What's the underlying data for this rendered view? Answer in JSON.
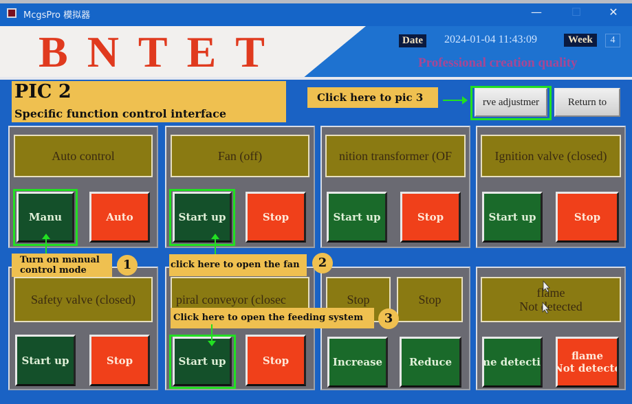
{
  "window": {
    "title": "McgsPro 模拟器",
    "minimize_icon": "minimize-icon",
    "maximize_icon": "maximize-icon",
    "close_icon": "close-icon",
    "minimize_glyph": "—",
    "maximize_glyph": "☐",
    "close_glyph": "✕"
  },
  "header": {
    "logo": "BNTET",
    "date_label": "Date",
    "date_value": "2024-01-04 11:43:09",
    "week_label": "Week",
    "week_value": "4",
    "slogan": "Professional creation quality"
  },
  "page": {
    "title": "PIC 2",
    "subtitle": "Specific function control interface"
  },
  "nav": {
    "hint": "Click here to pic 3",
    "curve_button": "rve adjustmer",
    "return_button": "Return to"
  },
  "panels": [
    {
      "status": "Auto control",
      "buttons": [
        {
          "label": "Manu",
          "color": "#14502a"
        },
        {
          "label": "Auto",
          "color": "#f0401a"
        }
      ]
    },
    {
      "status": "Fan (off)",
      "buttons": [
        {
          "label": "Start up",
          "color": "#14502a"
        },
        {
          "label": "Stop",
          "color": "#f0401a"
        }
      ]
    },
    {
      "status": "nition transformer (OF",
      "buttons": [
        {
          "label": "Start up",
          "color": "#1a6a2a"
        },
        {
          "label": "Stop",
          "color": "#f0401a"
        }
      ]
    },
    {
      "status": "Ignition valve (closed)",
      "buttons": [
        {
          "label": "Start up",
          "color": "#1a6a2a"
        },
        {
          "label": "Stop",
          "color": "#f0401a"
        }
      ]
    },
    {
      "status": "Safety valve (closed)",
      "buttons": [
        {
          "label": "Start up",
          "color": "#14502a"
        },
        {
          "label": "Stop",
          "color": "#f0401a"
        }
      ]
    },
    {
      "status": "piral conveyor (closec",
      "buttons": [
        {
          "label": "Start up",
          "color": "#14502a"
        },
        {
          "label": "Stop",
          "color": "#f0401a"
        }
      ]
    },
    {
      "status_left": "Stop",
      "status_right": "Stop",
      "buttons": [
        {
          "label": "Increase",
          "color": "#1a6a2a"
        },
        {
          "label": "Reduce",
          "color": "#1a6a2a"
        }
      ]
    },
    {
      "status_line1": "flame",
      "status_line2": "Not detected",
      "buttons": [
        {
          "label": "ame detecti",
          "color": "#1a6a2a"
        },
        {
          "label_line1": "flame",
          "label_line2": "Not detecte",
          "color": "#f0401a"
        }
      ]
    }
  ],
  "annotations": [
    {
      "number": "1",
      "line1": "Turn on manual",
      "line2": "control mode"
    },
    {
      "number": "2",
      "text": "click here to open the fan"
    },
    {
      "number": "3",
      "text": "Click here to open the feeding system"
    }
  ],
  "colors": {
    "window_blue": "#1565c8",
    "logo_red": "#e03a1e",
    "annotation_yellow": "#efc050",
    "highlight_green": "#22e022",
    "status_olive": "#8a7a12",
    "button_green": "#1a6a2a",
    "button_red": "#f0401a"
  }
}
